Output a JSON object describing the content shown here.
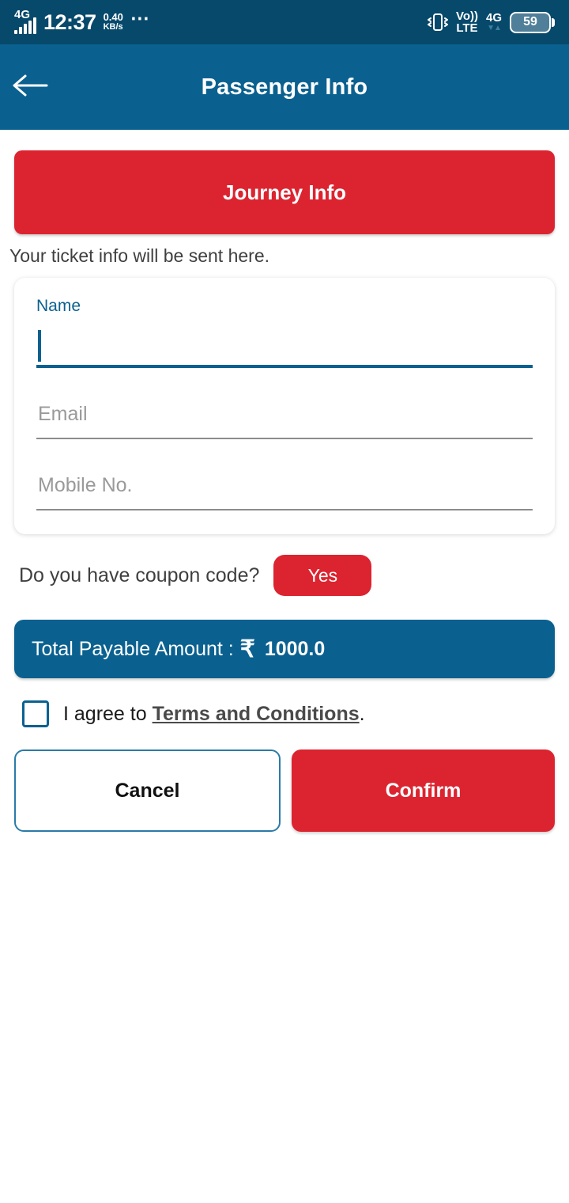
{
  "status_bar": {
    "network_type": "4G",
    "signal_icon": "signal-bars-icon",
    "time": "12:37",
    "data_speed_value": "0.40",
    "data_speed_unit": "KB/s",
    "overflow_icon": "more-dots-icon",
    "vibrate_icon": "vibrate-icon",
    "volte_top": "Vo))",
    "volte_bottom": "LTE",
    "network_right": "4G",
    "data_arrows": "▼▲",
    "battery_level": "59",
    "background_color": "#07496b"
  },
  "app_bar": {
    "back_icon": "back-arrow-icon",
    "title": "Passenger Info",
    "background_color": "#0a6190"
  },
  "journey": {
    "banner_label": "Journey Info",
    "banner_color": "#dc2430",
    "subtitle": "Your ticket info will be sent here."
  },
  "form": {
    "fields": [
      {
        "name": "name",
        "label": "Name",
        "placeholder": "Name",
        "value": "",
        "focused": true
      },
      {
        "name": "email",
        "label": "Email",
        "placeholder": "Email",
        "value": "",
        "focused": false
      },
      {
        "name": "mobile",
        "label": "Mobile No.",
        "placeholder": "Mobile No.",
        "value": "",
        "focused": false
      }
    ]
  },
  "coupon": {
    "question": "Do you have coupon code?",
    "yes_label": "Yes"
  },
  "total": {
    "label": "Total Payable Amount :",
    "currency_symbol": "₹",
    "amount": "1000.0",
    "background_color": "#0a6190"
  },
  "terms": {
    "checked": false,
    "prefix": "I agree to ",
    "link_text": "Terms and Conditions",
    "suffix": "."
  },
  "actions": {
    "cancel_label": "Cancel",
    "confirm_label": "Confirm",
    "confirm_color": "#dc2430"
  }
}
